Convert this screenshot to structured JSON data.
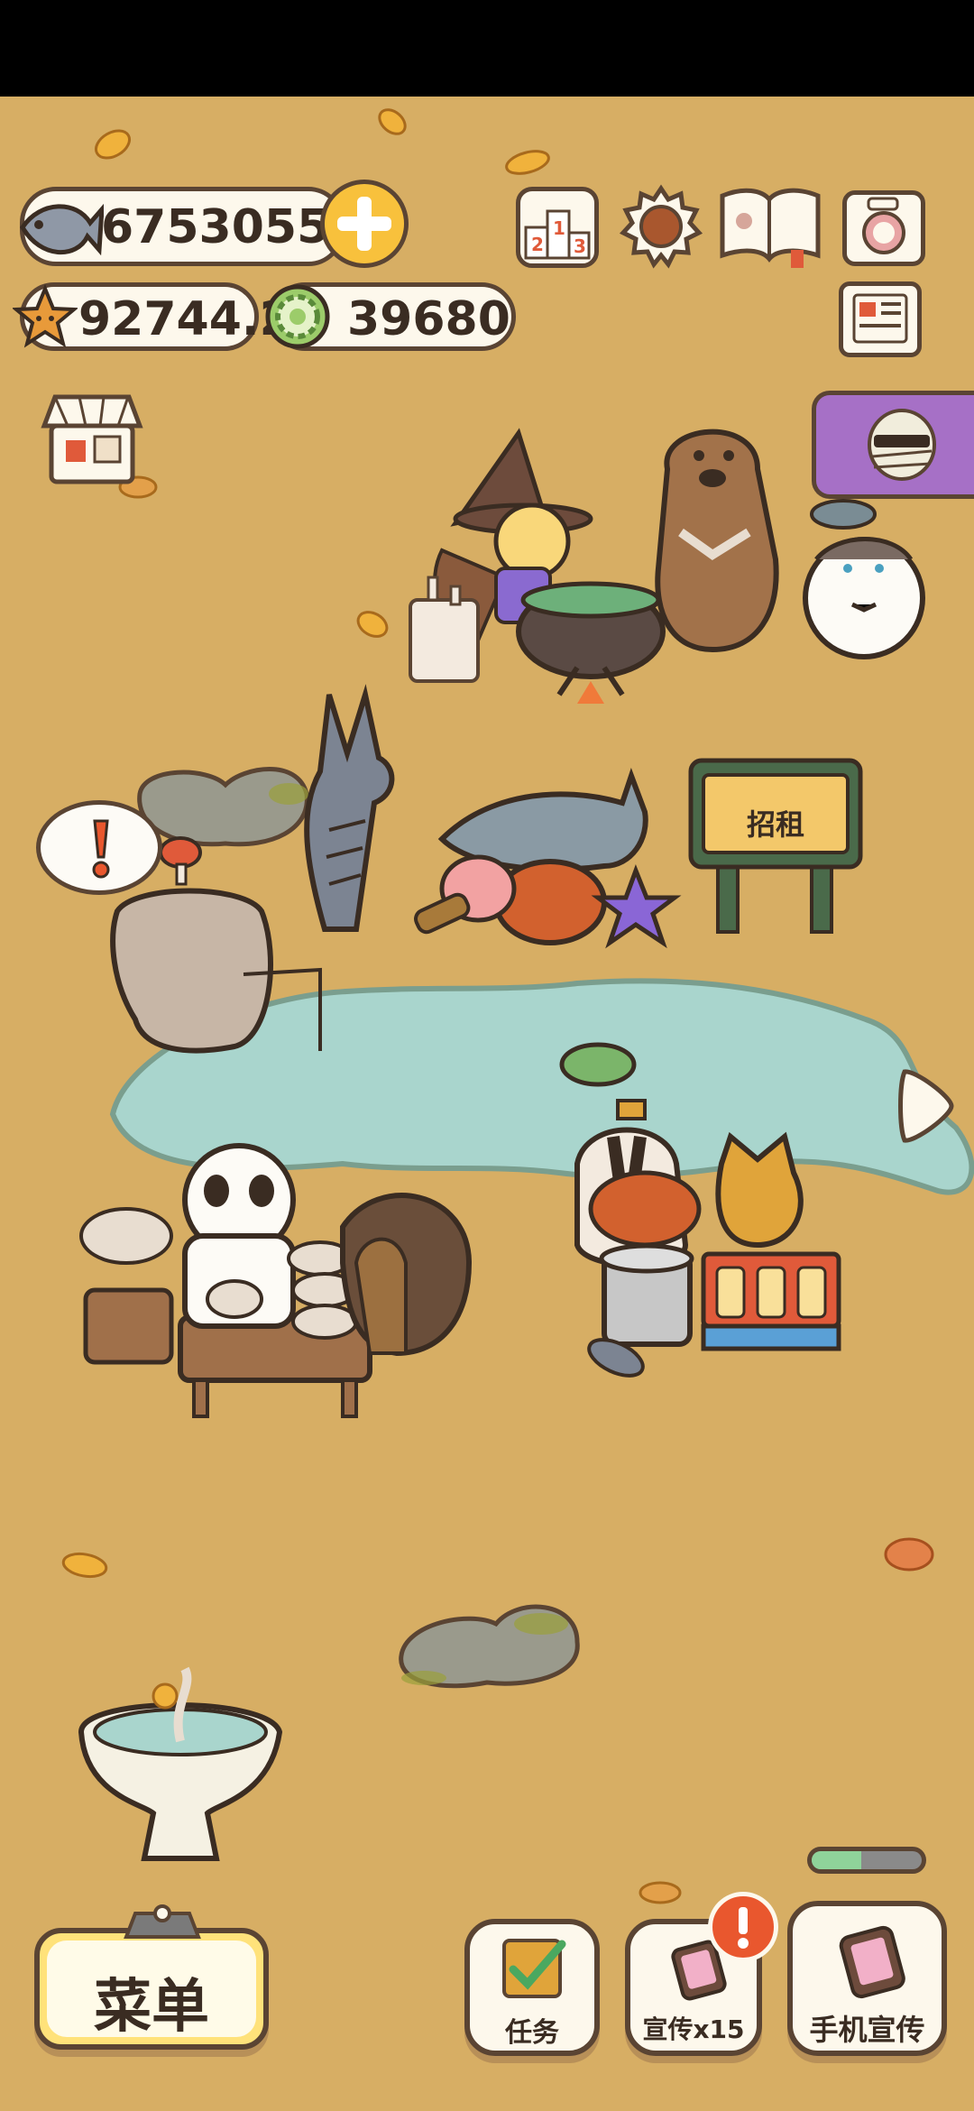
{
  "currency": {
    "fish": "6753055",
    "stars": "92744.2",
    "coins": "39680"
  },
  "sign": {
    "label": "招租"
  },
  "buttons": {
    "menu": "菜单",
    "tasks": "任务",
    "promote": "宣传x15",
    "phone_promote": "手机宣传"
  },
  "icons": [
    "fish-icon",
    "plus-icon",
    "ranking-icon",
    "settings-gear-icon",
    "guide-book-icon",
    "camera-icon",
    "star-icon",
    "coin-icon",
    "news-icon",
    "shop-icon",
    "mummy-event-icon",
    "next-arrow-icon",
    "alert-icon"
  ],
  "colors": {
    "ground": "#d7ae64",
    "pond": "#a9d5cd",
    "panel": "#fdf8ec",
    "outline": "#5a4433",
    "menu_yellow": "#ffe27a",
    "alert": "#e9572e"
  },
  "energy_level": 0.45
}
